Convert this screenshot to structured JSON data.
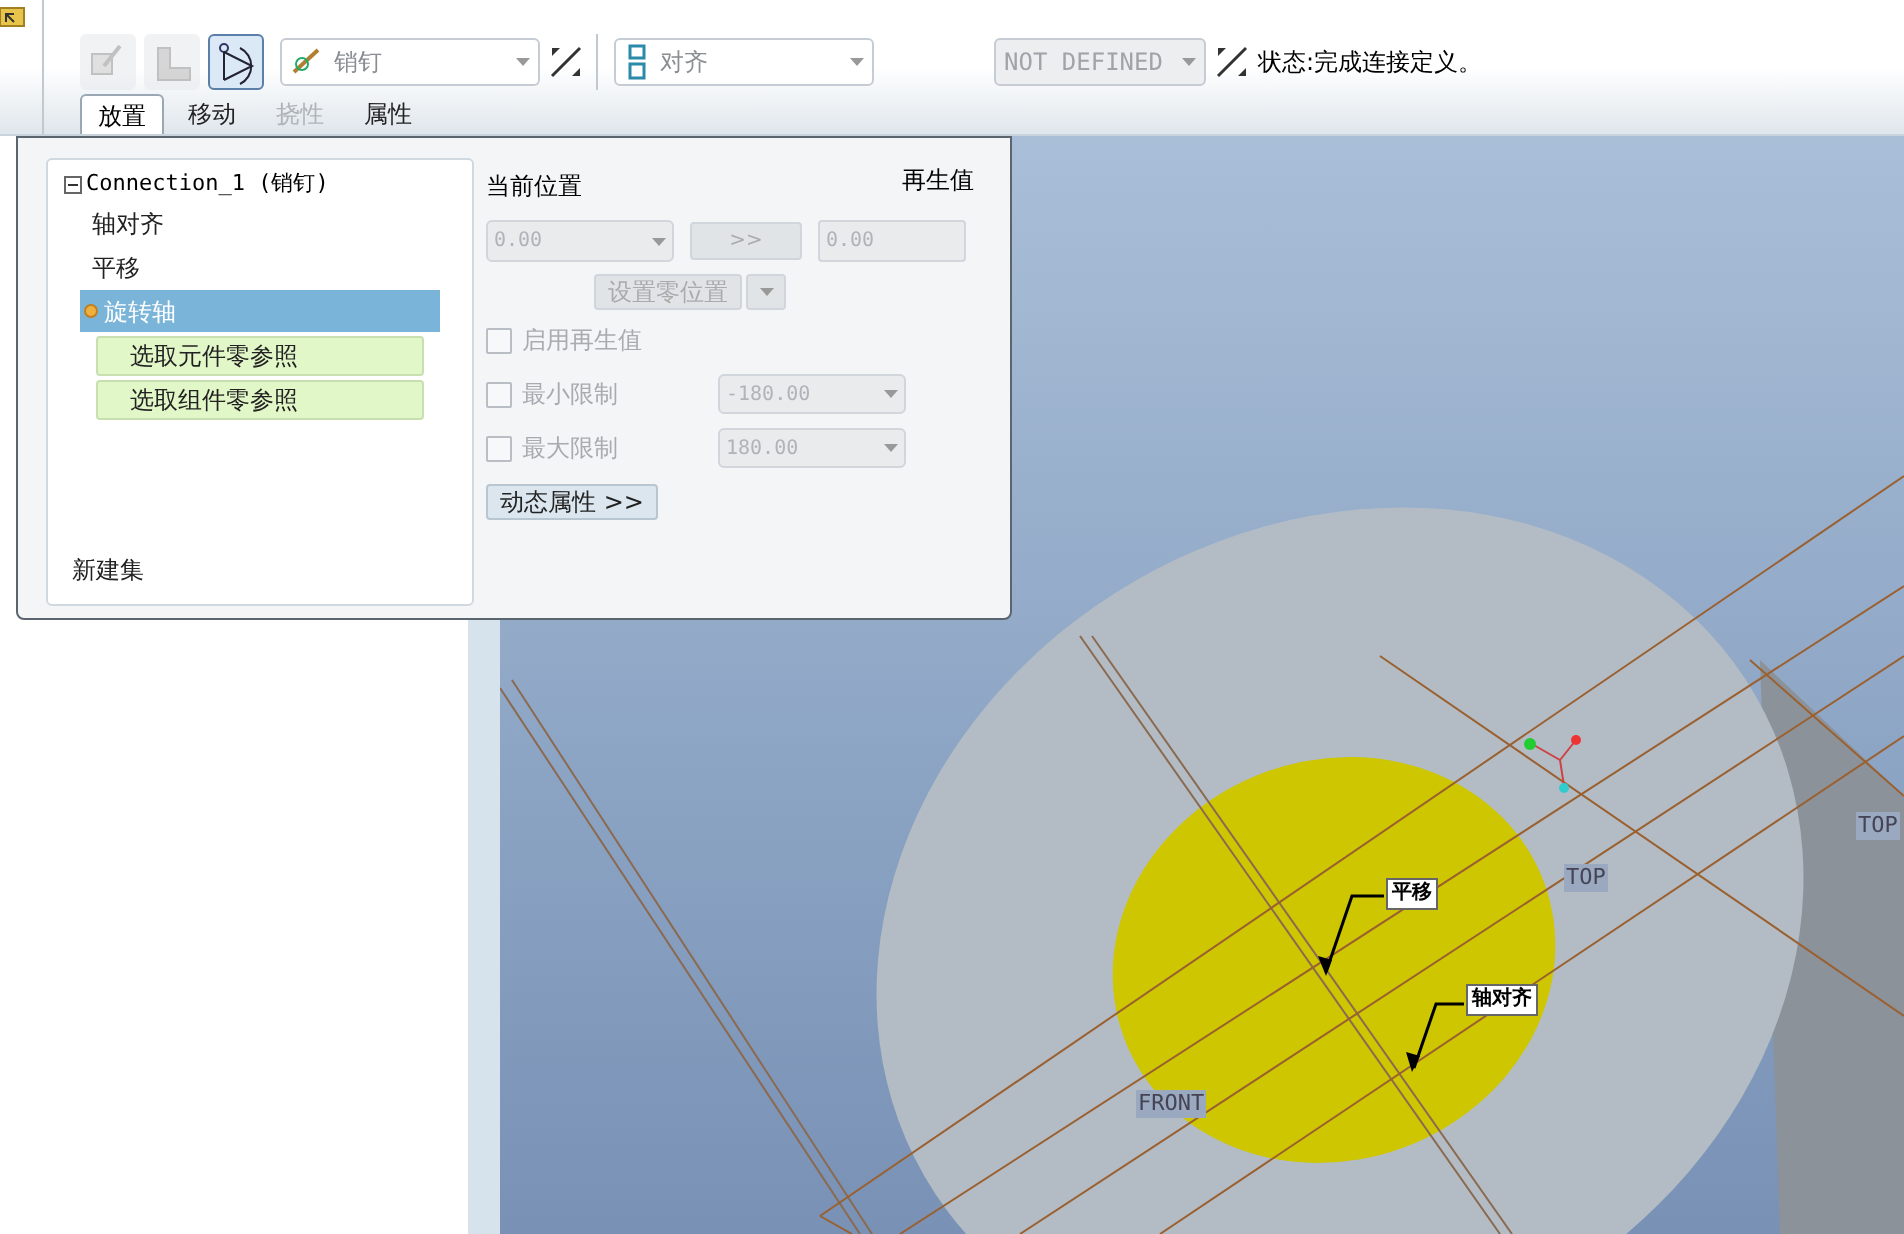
{
  "toolbar": {
    "tools": [
      {
        "disabled": true,
        "selected": false
      },
      {
        "disabled": true,
        "selected": false
      },
      {
        "disabled": false,
        "selected": true
      }
    ],
    "connection_type": {
      "value": "销钉"
    },
    "constraint_type": {
      "value": "对齐"
    },
    "offset": {
      "value": "NOT DEFINED",
      "disabled": true
    },
    "status": "状态:完成连接定义。"
  },
  "tabs": [
    {
      "label": "放置",
      "selected": true,
      "disabled": false
    },
    {
      "label": "移动",
      "selected": false,
      "disabled": false
    },
    {
      "label": "挠性",
      "selected": false,
      "disabled": true
    },
    {
      "label": "属性",
      "selected": false,
      "disabled": false
    }
  ],
  "panel": {
    "tree": {
      "label": "Connection_1 (销钉)",
      "expanded": true,
      "children": [
        {
          "label": "轴对齐",
          "selected": false
        },
        {
          "label": "平移",
          "selected": false
        },
        {
          "label": "旋转轴",
          "selected": true,
          "children": [
            {
              "label": "选取元件零参照"
            },
            {
              "label": "选取组件零参照"
            }
          ]
        }
      ]
    },
    "new_set": "新建集",
    "current_position_label": "当前位置",
    "regen_label": "再生值",
    "position_value": "0.00",
    "copy_button": ">>",
    "regen_value": "0.00",
    "set_zero_button": "设置零位置",
    "options": [
      {
        "label": "启用再生值",
        "checked": false
      },
      {
        "label": "最小限制",
        "checked": false,
        "value": "-180.00"
      },
      {
        "label": "最大限制",
        "checked": false,
        "value": "180.00"
      }
    ],
    "dynamic_button": "动态属性 >>"
  },
  "viewport": {
    "labels": [
      {
        "kind": "datum",
        "text": "TOP"
      },
      {
        "kind": "datum",
        "text": "TOP"
      },
      {
        "kind": "datum",
        "text": "FRONT"
      },
      {
        "kind": "callout",
        "text": "平移"
      },
      {
        "kind": "callout",
        "text": "轴对齐"
      }
    ]
  }
}
